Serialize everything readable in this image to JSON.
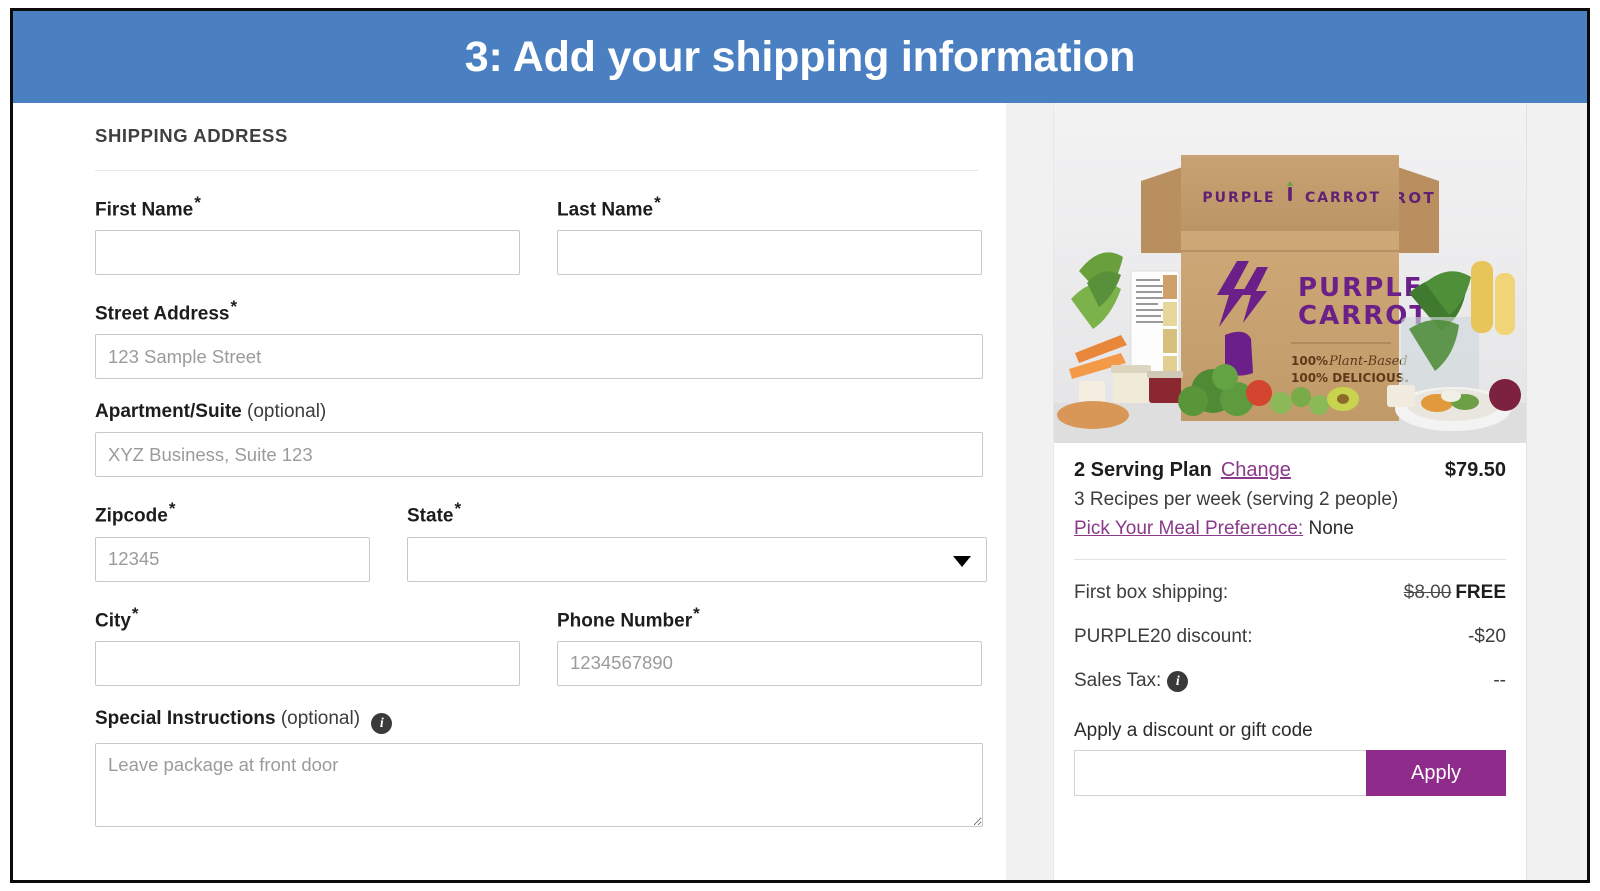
{
  "banner": {
    "title": "3: Add your shipping information"
  },
  "form": {
    "section_heading": "SHIPPING ADDRESS",
    "first_name": {
      "label": "First Name",
      "required": "*",
      "value": "",
      "placeholder": ""
    },
    "last_name": {
      "label": "Last Name",
      "required": "*",
      "value": "",
      "placeholder": ""
    },
    "street_address": {
      "label": "Street Address",
      "required": "*",
      "value": "",
      "placeholder": "123 Sample Street"
    },
    "apartment": {
      "label": "Apartment/Suite",
      "optional": "(optional)",
      "value": "",
      "placeholder": "XYZ Business, Suite 123"
    },
    "zipcode": {
      "label": "Zipcode",
      "required": "*",
      "value": "",
      "placeholder": "12345"
    },
    "state": {
      "label": "State",
      "required": "*",
      "value": "",
      "selected": "",
      "options": []
    },
    "city": {
      "label": "City",
      "required": "*",
      "value": "",
      "placeholder": ""
    },
    "phone": {
      "label": "Phone Number",
      "required": "*",
      "value": "",
      "placeholder": "1234567890"
    },
    "special_instructions": {
      "label": "Special Instructions",
      "optional": "(optional)",
      "info_icon": "info-icon",
      "value": "",
      "placeholder": "Leave package at front door"
    }
  },
  "summary": {
    "hero_image": {
      "brand_lockup": "PURPLE | CARROT",
      "brand_line1": "PURPLE",
      "brand_line2": "CARROT",
      "tagline1": "100% Plant-Based",
      "tagline2": "100% DELICIOUS."
    },
    "plan_name": "2 Serving Plan",
    "change_label": "Change",
    "plan_price": "$79.50",
    "plan_subtitle": "3 Recipes per week (serving 2 people)",
    "preference_link": "Pick Your Meal Preference:",
    "preference_value": "None",
    "lines": [
      {
        "label": "First box shipping:",
        "strike": "$8.00",
        "value": "FREE"
      },
      {
        "label": "PURPLE20 discount:",
        "value": "-$20"
      },
      {
        "label": "Sales Tax:",
        "value": "--",
        "info_icon": "info-icon"
      }
    ],
    "promo_label": "Apply a discount or gift code",
    "promo_value": "",
    "promo_placeholder": "",
    "apply_label": "Apply"
  },
  "colors": {
    "banner_blue": "#4a80c2",
    "brand_purple": "#8f2b8b",
    "link_purple": "#8a3a8a"
  }
}
